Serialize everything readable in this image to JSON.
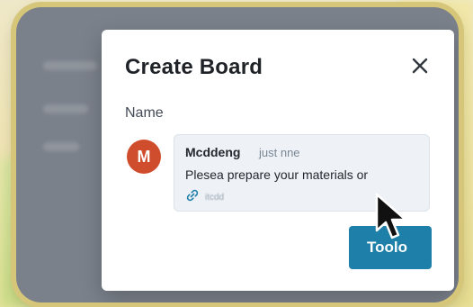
{
  "modal": {
    "title": "Create Board",
    "close_symbol": "✕",
    "name_label": "Name",
    "tools_button_label": "Toolo"
  },
  "comment": {
    "avatar_initial": "M",
    "author": "Mcddeng",
    "time": "just nne",
    "text": "Plesea prepare your materials or",
    "attachment_text": "itcdd"
  },
  "colors": {
    "avatar": "#cf4d2d",
    "primary_button": "#1e7fa8",
    "link_icon": "#1e7fa8"
  },
  "icons": {
    "close": "close-icon",
    "attachment": "link-icon",
    "pointer": "mouse-cursor-icon"
  }
}
